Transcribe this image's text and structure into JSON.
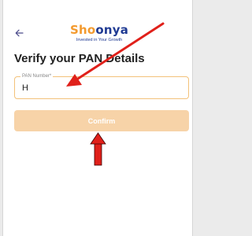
{
  "header": {
    "back_icon": "arrow-left-icon",
    "logo": {
      "part1": "Sho",
      "part2": "onya",
      "tagline": "Invested in Your Growth"
    }
  },
  "form": {
    "title": "Verify your PAN Details",
    "pan_field": {
      "label": "PAN Number*",
      "value": "H"
    },
    "confirm_label": "Confirm"
  },
  "colors": {
    "brand_orange": "#f39a2e",
    "brand_blue": "#1f3a93",
    "confirm_disabled": "#f7d3a8",
    "field_border": "#f3c27a",
    "annotation_red": "#e0201a"
  }
}
